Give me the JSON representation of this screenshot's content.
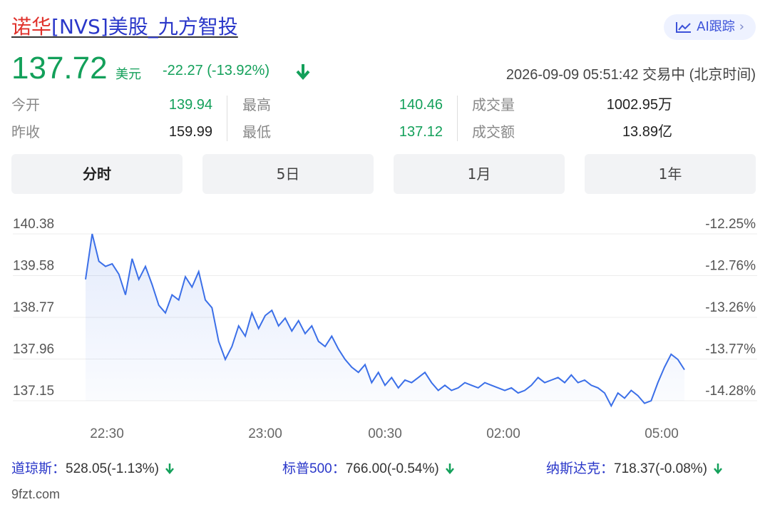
{
  "header": {
    "stock_name": "诺华",
    "stock_rest": "[NVS]美股_九方智投",
    "ai_button_label": "AI跟踪"
  },
  "quote": {
    "price": "137.72",
    "unit": "美元",
    "change": "-22.27 (-13.92%)",
    "timestamp": "2026-09-09 05:51:42 交易中 (北京时间)"
  },
  "stats": {
    "open_label": "今开",
    "open_value": "139.94",
    "prev_close_label": "昨收",
    "prev_close_value": "159.99",
    "high_label": "最高",
    "high_value": "140.46",
    "low_label": "最低",
    "low_value": "137.12",
    "volume_label": "成交量",
    "volume_value": "1002.95万",
    "turnover_label": "成交额",
    "turnover_value": "13.89亿"
  },
  "tabs": [
    {
      "label": "分时",
      "active": true
    },
    {
      "label": "5日",
      "active": false
    },
    {
      "label": "1月",
      "active": false
    },
    {
      "label": "1年",
      "active": false
    }
  ],
  "chart_data": {
    "type": "line",
    "title": "",
    "y_ticks": [
      "140.38",
      "139.58",
      "138.77",
      "137.96",
      "137.15"
    ],
    "y2_ticks": [
      "-12.25%",
      "-12.76%",
      "-13.26%",
      "-13.77%",
      "-14.28%"
    ],
    "x_ticks": [
      "22:30",
      "23:00",
      "00:30",
      "02:00",
      "05:00"
    ],
    "ylim": [
      137.15,
      140.38
    ],
    "line_color": "#3b6fe8",
    "series": [
      {
        "values": [
          139.5,
          140.38,
          139.85,
          139.75,
          139.8,
          139.6,
          139.2,
          139.9,
          139.5,
          139.75,
          139.4,
          139.0,
          138.85,
          139.2,
          139.1,
          139.55,
          139.35,
          139.65,
          139.1,
          138.95,
          138.3,
          137.95,
          138.2,
          138.6,
          138.4,
          138.85,
          138.55,
          138.8,
          138.9,
          138.6,
          138.75,
          138.5,
          138.7,
          138.45,
          138.6,
          138.3,
          138.2,
          138.4,
          138.15,
          137.95,
          137.8,
          137.7,
          137.85,
          137.5,
          137.7,
          137.45,
          137.6,
          137.4,
          137.55,
          137.5,
          137.6,
          137.7,
          137.5,
          137.35,
          137.45,
          137.35,
          137.4,
          137.5,
          137.45,
          137.4,
          137.5,
          137.45,
          137.4,
          137.35,
          137.4,
          137.3,
          137.35,
          137.45,
          137.6,
          137.5,
          137.55,
          137.6,
          137.5,
          137.65,
          137.5,
          137.55,
          137.45,
          137.4,
          137.3,
          137.05,
          137.3,
          137.2,
          137.35,
          137.25,
          137.1,
          137.15,
          137.5,
          137.8,
          138.05,
          137.95,
          137.75
        ]
      }
    ]
  },
  "indices": [
    {
      "name": "道琼斯：",
      "value": "528.05(-1.13%)"
    },
    {
      "name": "标普500：",
      "value": "766.00(-0.54%)"
    },
    {
      "name": "纳斯达克：",
      "value": "718.37(-0.08%)"
    }
  ],
  "source": "9fzt.com",
  "colors": {
    "up_down_green": "#13a05a",
    "link_blue": "#2a37c9",
    "stock_red": "#e0312b"
  }
}
